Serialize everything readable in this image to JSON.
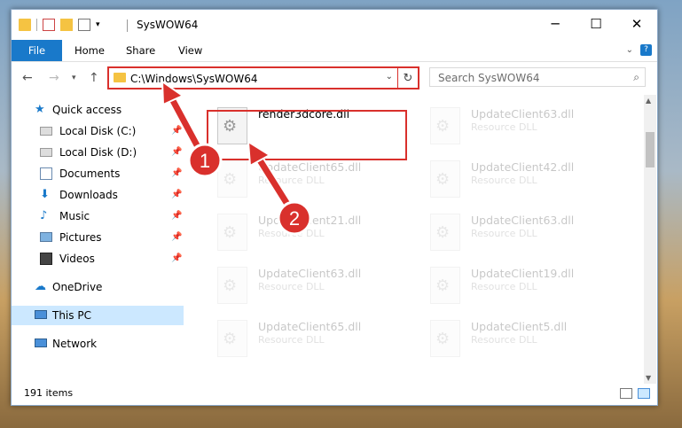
{
  "window": {
    "title": "SysWOW64"
  },
  "ribbon": {
    "tabs": [
      "File",
      "Home",
      "Share",
      "View"
    ]
  },
  "address": {
    "path": "C:\\Windows\\SysWOW64"
  },
  "search": {
    "placeholder": "Search SysWOW64"
  },
  "nav": {
    "quick_access": "Quick access",
    "items": [
      {
        "label": "Local Disk (C:)",
        "icon": "drive-icon",
        "pinned": true
      },
      {
        "label": "Local Disk (D:)",
        "icon": "drive-icon",
        "pinned": true
      },
      {
        "label": "Documents",
        "icon": "documents-icon",
        "pinned": true
      },
      {
        "label": "Downloads",
        "icon": "download-icon",
        "pinned": true
      },
      {
        "label": "Music",
        "icon": "music-icon",
        "pinned": true
      },
      {
        "label": "Pictures",
        "icon": "pictures-icon",
        "pinned": true
      },
      {
        "label": "Videos",
        "icon": "videos-icon",
        "pinned": true
      }
    ],
    "onedrive": "OneDrive",
    "this_pc": "This PC",
    "network": "Network"
  },
  "files": [
    {
      "name": "render3dcore.dll",
      "desc": ""
    },
    {
      "name": "UpdateClient63.dll",
      "desc": "Resource DLL"
    },
    {
      "name": "UpdateClient65.dll",
      "desc": "Resource DLL"
    },
    {
      "name": "UpdateClient42.dll",
      "desc": "Resource DLL"
    },
    {
      "name": "UpdateClient21.dll",
      "desc": "Resource DLL"
    },
    {
      "name": "UpdateClient63.dll",
      "desc": "Resource DLL"
    },
    {
      "name": "UpdateClient63.dll",
      "desc": "Resource DLL"
    },
    {
      "name": "UpdateClient19.dll",
      "desc": "Resource DLL"
    },
    {
      "name": "UpdateClient65.dll",
      "desc": "Resource DLL"
    },
    {
      "name": "UpdateClient5.dll",
      "desc": "Resource DLL"
    }
  ],
  "status": {
    "count": "191 items"
  },
  "annotations": {
    "step1": "1",
    "step2": "2"
  },
  "colors": {
    "accent": "#1979ca",
    "highlight": "#d9302c",
    "selected": "#cce8ff"
  }
}
